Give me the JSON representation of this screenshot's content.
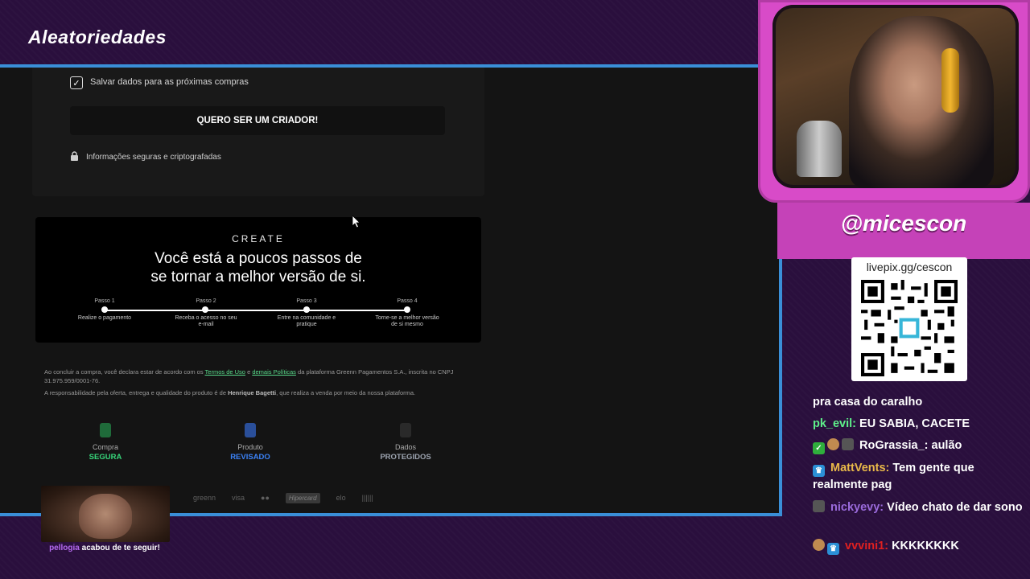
{
  "stream": {
    "title": "Aleatoriedades",
    "channel_name": "@micescon",
    "qr_url": "livepix.gg/cescon"
  },
  "checkout": {
    "save_label": "Salvar dados para as próximas compras",
    "creator_button": "QUERO SER UM CRIADOR!",
    "secure_text": "Informações seguras e criptografadas",
    "banner": {
      "brand": "CREATE",
      "headline_line1": "Você está a poucos passos de",
      "headline_line2": "se tornar a melhor versão de si.",
      "steps": [
        {
          "title": "Passo 1",
          "desc": "Realize o pagamento"
        },
        {
          "title": "Passo 2",
          "desc": "Receba o acesso no seu e-mail"
        },
        {
          "title": "Passo 3",
          "desc": "Entre na comunidade e pratique"
        },
        {
          "title": "Passo 4",
          "desc": "Torne-se a melhor versão de si mesmo"
        }
      ]
    },
    "legal": {
      "part1": "Ao concluir a compra, você declara estar de acordo com os ",
      "terms_link": "Termos de Uso",
      "part2": " e ",
      "policies_link": "demais Políticas",
      "part3": " da plataforma Greenn Pagamentos S.A., inscrita no CNPJ 31.975.959/0001-76.",
      "resp_part1": "A responsabilidade pela oferta, entrega e qualidade do produto é de ",
      "resp_name": "Henrique Bagetti",
      "resp_part2": ", que realiza a venda por meio da nossa plataforma."
    },
    "badges": [
      {
        "top": "Compra",
        "bottom": "SEGURA",
        "color": "#37d67a",
        "icon": "lock-icon"
      },
      {
        "top": "Produto",
        "bottom": "REVISADO",
        "color": "#3b82f6",
        "icon": "document-check-icon"
      },
      {
        "top": "Dados",
        "bottom": "PROTEGIDOS",
        "color": "#9ca3af",
        "icon": "shield-icon"
      }
    ],
    "payment_logos": [
      "greenn",
      "visa",
      "mastercard",
      "Hipercard",
      "elo",
      "boleto"
    ]
  },
  "alert": {
    "username": "pellogia",
    "message": " acabou de te seguir!"
  },
  "chat": [
    {
      "user": "",
      "user_color": "#ffffff",
      "badges": [],
      "message": "pra casa do caralho"
    },
    {
      "user": "pk_evil:",
      "user_color": "#5ef08a",
      "badges": [],
      "message": "EU SABIA, CACETE"
    },
    {
      "user": "RoGrassia_:",
      "user_color": "#ffffff",
      "badges": [
        "check-badge-icon",
        "cookie-badge-icon",
        "bits-badge-icon"
      ],
      "message": "aulão"
    },
    {
      "user": "MattVents:",
      "user_color": "#e9b949",
      "badges": [
        "crown-badge-icon"
      ],
      "message": "Tem gente que realmente pag"
    },
    {
      "user": "nickyevy:",
      "user_color": "#9b6bdc",
      "badges": [
        "bits-badge-icon"
      ],
      "message": "Vídeo chato de dar sono"
    },
    {
      "user": "vvvini1:",
      "user_color": "#e02020",
      "badges": [
        "cookie-badge-icon",
        "crown-badge-icon"
      ],
      "message": "KKKKKKKK"
    }
  ],
  "colors": {
    "background": "#2a0f3d",
    "capture_border": "#3a8fd8",
    "cam_frame": "#d84bc8"
  }
}
